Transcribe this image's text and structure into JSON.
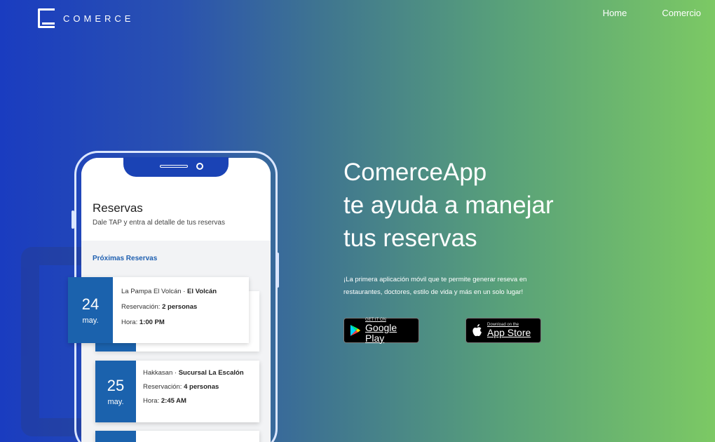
{
  "header": {
    "logo_text": "COMERCE",
    "nav": [
      "Home",
      "Comercio"
    ]
  },
  "phone": {
    "title": "Reservas",
    "subtitle": "Dale TAP y entra al detalle de tus reservas",
    "section_label": "Próximas Reservas",
    "cards": [
      {
        "day": "24",
        "month": "may.",
        "place": "La Pampa El Volcán",
        "branch": "El Volcán",
        "guests_label": "Reservación:",
        "guests": "2 personas",
        "time_label": "Hora:",
        "time": "1:00 PM"
      },
      {
        "day": "25",
        "month": "may.",
        "place": "Hakkasan",
        "branch": "Sucursal La Escalón",
        "guests_label": "Reservación:",
        "guests": "4 personas",
        "time_label": "Hora:",
        "time": "2:45 AM"
      }
    ]
  },
  "hero": {
    "line1": "ComerceApp",
    "line2": "te ayuda a manejar",
    "line3": "tus reservas",
    "description": "¡La primera aplicación móvil que te permite generar reseva en restaurantes, doctores, estilo de vida y más en un solo lugar!"
  },
  "stores": {
    "google_small": "GET IT ON",
    "google_big": "Google Play",
    "apple_small": "Download on the",
    "apple_big": "App Store"
  }
}
